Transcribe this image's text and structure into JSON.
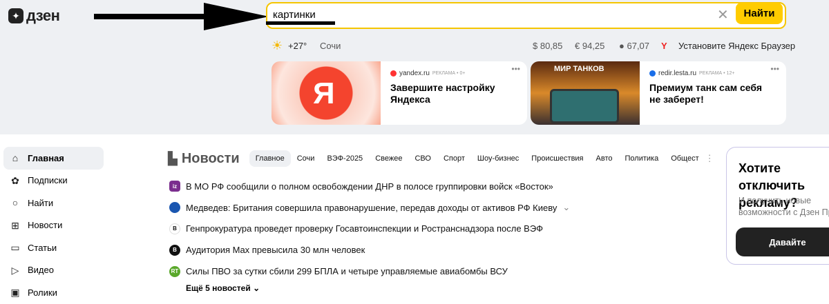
{
  "logo": "дзен",
  "search": {
    "value": "картинки",
    "button": "Найти"
  },
  "weather": {
    "temp": "+27°",
    "city": "Сочи"
  },
  "rates": {
    "usd": "$ 80,85",
    "eur": "€ 94,25",
    "oil": "67,07"
  },
  "browser_promo": "Установите Яндекс Браузер",
  "ads": [
    {
      "source": "yandex.ru",
      "label": "РЕКЛАМА • 0+",
      "title": "Завершите настройку Яндекса",
      "logo": "Я"
    },
    {
      "source": "redir.lesta.ru",
      "label": "РЕКЛАМА • 12+",
      "title": "Премиум танк сам себя не заберет!",
      "logo": "МИР ТАНКОВ"
    }
  ],
  "sidebar": [
    {
      "label": "Главная",
      "icon": "home-icon"
    },
    {
      "label": "Подписки",
      "icon": "subscriptions-icon"
    },
    {
      "label": "Найти",
      "icon": "search-icon"
    },
    {
      "label": "Новости",
      "icon": "news-icon"
    },
    {
      "label": "Статьи",
      "icon": "articles-icon"
    },
    {
      "label": "Видео",
      "icon": "video-icon"
    },
    {
      "label": "Ролики",
      "icon": "clips-icon"
    }
  ],
  "news": {
    "title": "Новости",
    "tabs": [
      "Главное",
      "Сочи",
      "ВЭФ-2025",
      "Свежее",
      "СВО",
      "Спорт",
      "Шоу-бизнес",
      "Происшествия",
      "Авто",
      "Политика",
      "Общест"
    ],
    "items": [
      {
        "text": "В МО РФ сообщили о полном освобождении ДНР в полосе группировки войск «Восток»",
        "icon": "iz",
        "color": "#7b2e8e"
      },
      {
        "text": "Медведев: Британия совершила правонарушение, передав доходы от активов РФ Киеву",
        "icon": "",
        "color": "#1a56b0"
      },
      {
        "text": "Генпрокуратура проведет проверку Госавтоинспекции и Ространснадзора после ВЭФ",
        "icon": "В",
        "color": "#ffffff"
      },
      {
        "text": "Аудитория Max превысила 30 млн человек",
        "icon": "В",
        "color": "#111111"
      },
      {
        "text": "Силы ПВО за сутки сбили 299 БПЛА и четыре управляемые авиабомбы ВСУ",
        "icon": "RT",
        "color": "#5aa82b"
      }
    ],
    "more": "Ещё 5 новостей"
  },
  "pro": {
    "title": "Хотите отключить рекламу?",
    "subtitle": "И получить новые возможности с Дзен Про",
    "button": "Давайте"
  }
}
